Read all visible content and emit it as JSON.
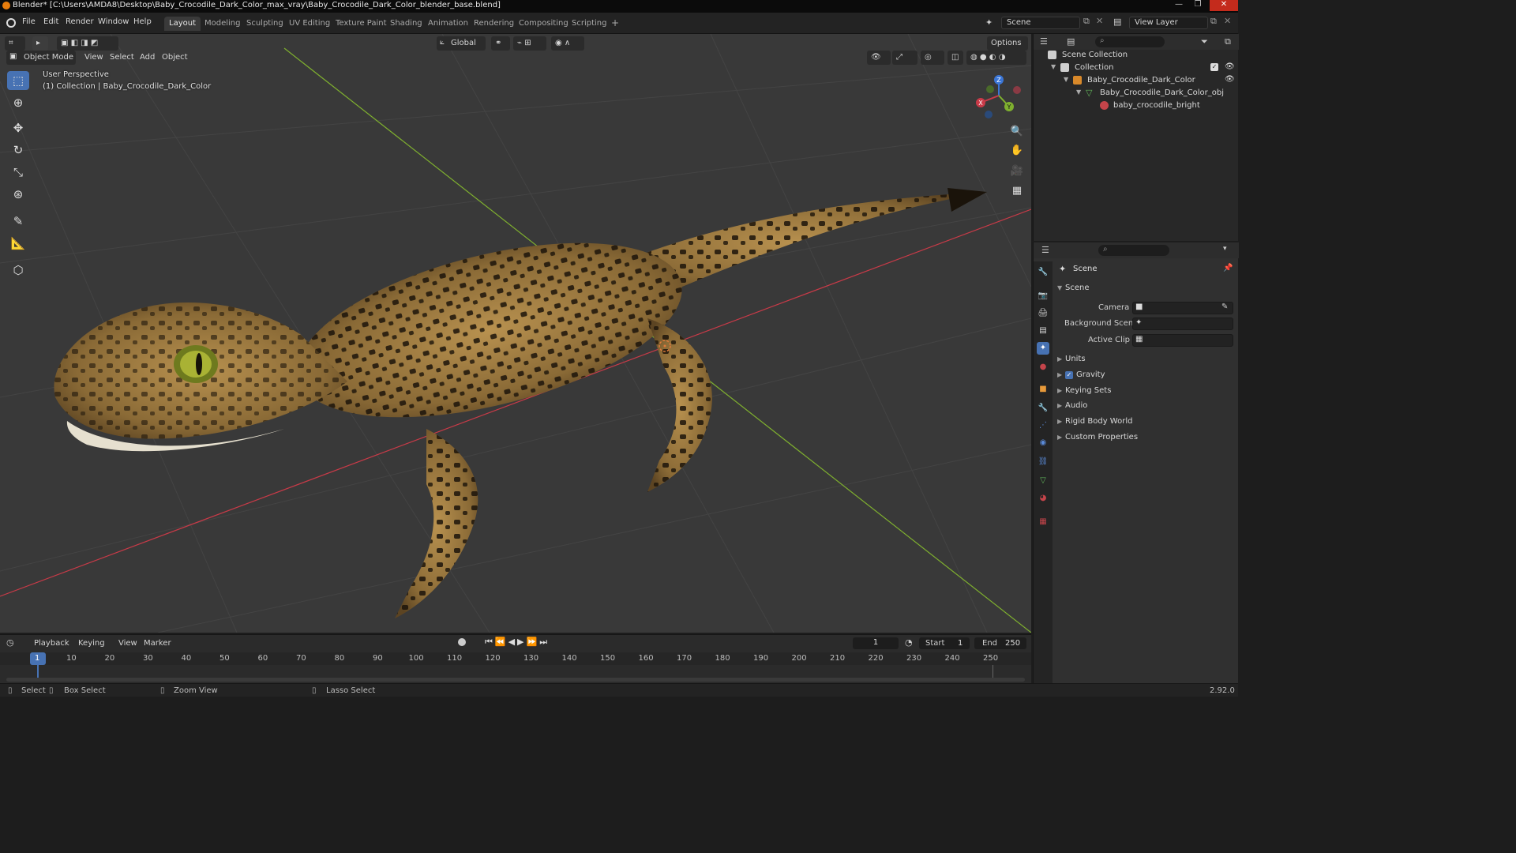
{
  "window": {
    "title": "Blender* [C:\\Users\\AMDA8\\Desktop\\Baby_Crocodile_Dark_Color_max_vray\\Baby_Crocodile_Dark_Color_blender_base.blend]",
    "minimize": "—",
    "maximize": "❐",
    "close": "✕"
  },
  "menubar": {
    "items": [
      "File",
      "Edit",
      "Render",
      "Window",
      "Help"
    ],
    "workspaces": [
      "Layout",
      "Modeling",
      "Sculpting",
      "UV Editing",
      "Texture Paint",
      "Shading",
      "Animation",
      "Rendering",
      "Compositing",
      "Scripting"
    ],
    "active_workspace": "Layout",
    "add_workspace": "+",
    "scene": "Scene",
    "view_layer": "View Layer"
  },
  "viewport_header": {
    "mode": "Object Mode",
    "menus": [
      "View",
      "Select",
      "Add",
      "Object"
    ],
    "orientation": "Global",
    "options": "Options"
  },
  "viewport": {
    "perspective": "User Perspective",
    "collection_info": "(1) Collection | Baby_Crocodile_Dark_Color",
    "gizmo": {
      "x": "X",
      "y": "Y",
      "z": "Z"
    }
  },
  "outliner": {
    "rows": [
      {
        "label": "Scene Collection"
      },
      {
        "label": "Collection"
      },
      {
        "label": "Baby_Crocodile_Dark_Color"
      },
      {
        "label": "Baby_Crocodile_Dark_Color_obj"
      },
      {
        "label": "baby_crocodile_bright"
      }
    ]
  },
  "properties": {
    "context": "Scene",
    "section": "Scene",
    "fields": {
      "camera": "Camera",
      "background_scene": "Background Scene",
      "active_clip": "Active Clip"
    },
    "panels": [
      "Units",
      "Gravity",
      "Keying Sets",
      "Audio",
      "Rigid Body World",
      "Custom Properties"
    ],
    "gravity_checked": true
  },
  "timeline": {
    "menus": [
      "Playback",
      "Keying",
      "View",
      "Marker"
    ],
    "current_frame": "1",
    "start_label": "Start",
    "start": "1",
    "end_label": "End",
    "end": "250",
    "ticks": [
      "1",
      "10",
      "20",
      "30",
      "40",
      "50",
      "60",
      "70",
      "80",
      "90",
      "100",
      "110",
      "120",
      "130",
      "140",
      "150",
      "160",
      "170",
      "180",
      "190",
      "200",
      "210",
      "220",
      "230",
      "240",
      "250"
    ]
  },
  "statusbar": {
    "select": "Select",
    "box_select": "Box Select",
    "zoom_view": "Zoom View",
    "lasso_select": "Lasso Select",
    "version": "2.92.0"
  },
  "colors": {
    "accent": "#4772b3",
    "x_axis": "#c93a48",
    "y_axis": "#7fb02f",
    "z_axis": "#3b76d6",
    "viewport_bg": "#393939"
  }
}
